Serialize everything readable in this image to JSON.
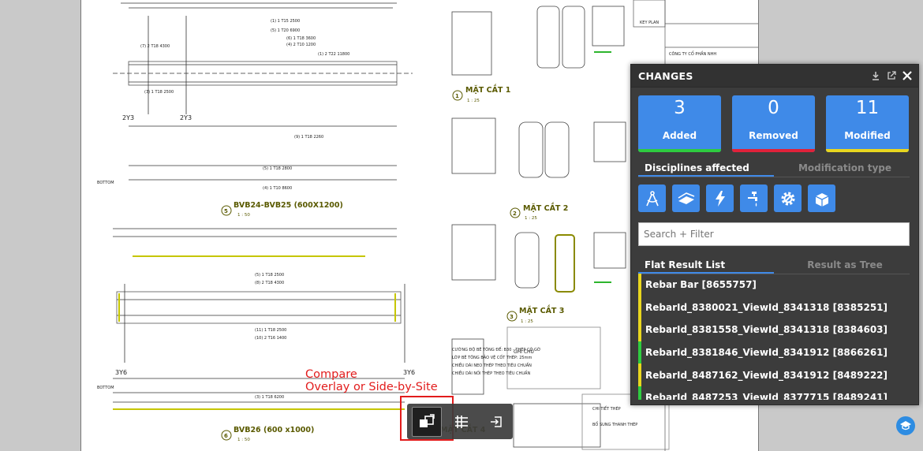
{
  "panel": {
    "title": "CHANGES",
    "stats": [
      {
        "value": "3",
        "label": "Added",
        "color": "#2ecc40"
      },
      {
        "value": "0",
        "label": "Removed",
        "color": "#e0223a"
      },
      {
        "value": "11",
        "label": "Modified",
        "color": "#e8d61f"
      }
    ],
    "tabs_top": {
      "active": "Disciplines affected",
      "inactive": "Modification type"
    },
    "disciplines": [
      "architecture-icon",
      "structural-icon",
      "electrical-icon",
      "plumbing-icon",
      "mechanical-icon",
      "other-icon"
    ],
    "search_placeholder": "Search + Filter",
    "tabs_results": {
      "active": "Flat Result List",
      "inactive": "Result as Tree"
    },
    "results": [
      {
        "label": "Rebar Bar [8655757]",
        "status": "modified",
        "color": "#e8d61f"
      },
      {
        "label": "RebarId_8380021_ViewId_8341318 [8385251]",
        "status": "modified",
        "color": "#e8d61f"
      },
      {
        "label": "RebarId_8381558_ViewId_8341318 [8384603]",
        "status": "modified",
        "color": "#e8d61f"
      },
      {
        "label": "RebarId_8381846_ViewId_8341912 [8866261]",
        "status": "added",
        "color": "#2ecc40"
      },
      {
        "label": "RebarId_8487162_ViewId_8341912 [8489222]",
        "status": "modified",
        "color": "#e8d61f"
      },
      {
        "label": "RebarId_8487253_ViewId_8377715 [8489241]",
        "status": "added",
        "color": "#2ecc40"
      }
    ]
  },
  "callout": {
    "line1": "Compare",
    "line2": "Overlay or Side-by-Site"
  },
  "toolbar": [
    "compare-overlay-icon",
    "list-icon",
    "exit-icon"
  ],
  "drawing": {
    "titles": [
      {
        "num": "5",
        "text": "BVB24-BVB25 (600X1200)",
        "scale": "1 : 50"
      },
      {
        "num": "6",
        "text": "BVB26 (600 x1000)",
        "scale": "1 : 50"
      },
      {
        "num": "1",
        "text": "MẶT CẮT 1",
        "scale": "1 : 25"
      },
      {
        "num": "2",
        "text": "MẶT CẮT 2",
        "scale": "1 : 25"
      },
      {
        "num": "3",
        "text": "MẶT CẮT 3",
        "scale": "1 : 25"
      },
      {
        "num": "",
        "text": "MẶT CẮT 4",
        "scale": ""
      }
    ],
    "grid_marks": [
      "2Y3",
      "2Y3",
      "3Y6",
      "3Y6"
    ],
    "notes_title": "GHI CHÚ",
    "company": "CÔNG TY CỔ PHẦN NHH",
    "key_plan": "KEY PLAN"
  }
}
